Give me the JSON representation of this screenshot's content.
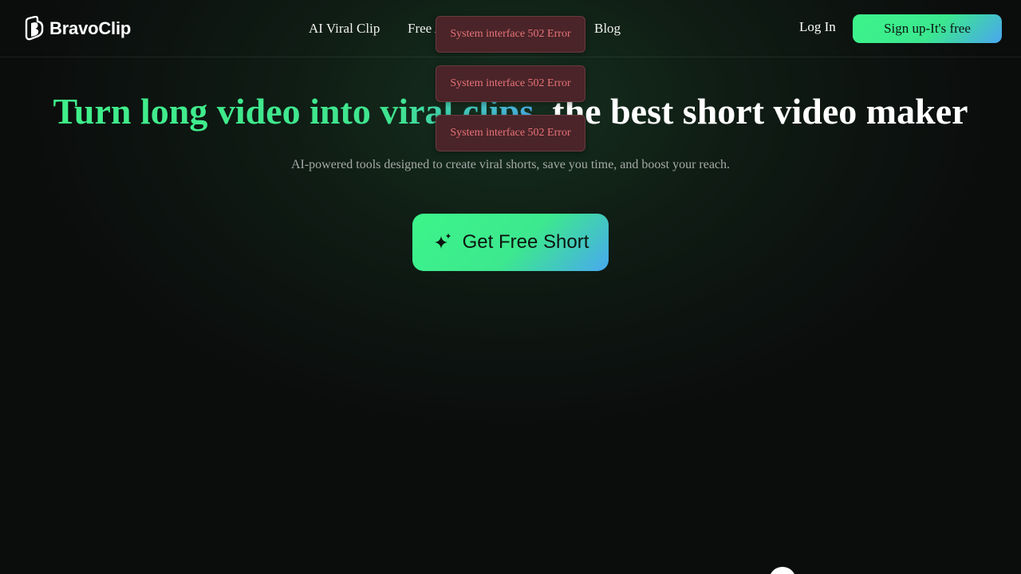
{
  "brand": {
    "name": "BravoClip"
  },
  "nav": {
    "items": [
      {
        "label": "AI Viral Clip"
      },
      {
        "label": "Free AI Tools"
      },
      {
        "label": "Blog"
      }
    ],
    "login_label": "Log In",
    "signup_label": "Sign up-It's free"
  },
  "hero": {
    "title_highlight": "Turn long video into viral clips,",
    "title_rest": "the best short video maker",
    "subtitle": "AI-powered tools designed to create viral shorts, save you time, and boost your reach.",
    "cta_label": "Get Free Short",
    "cta_icon": "sparkle-icon"
  },
  "toasts": [
    {
      "message": "System interface 502 Error"
    },
    {
      "message": "System interface 502 Error"
    },
    {
      "message": "System interface 502 Error"
    }
  ],
  "colors": {
    "accent_green": "#3cf58a",
    "accent_blue": "#4aa5f0",
    "background": "#0b0c0c",
    "error_text": "#e8737a",
    "error_bg": "#4a2428"
  }
}
